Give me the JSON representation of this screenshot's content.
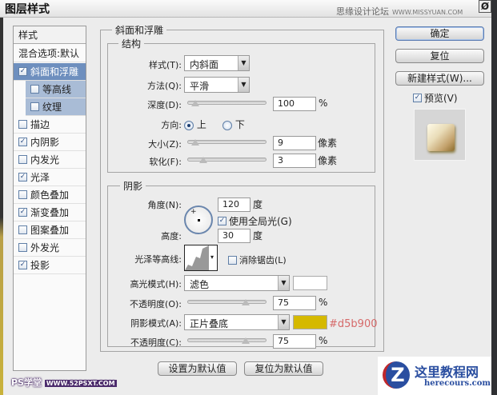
{
  "window": {
    "title": "图层样式",
    "watermark": "思缘设计论坛",
    "watermark_url": "WWW.MISSYUAN.COM",
    "close_icon": "Ø"
  },
  "sidebar": {
    "header": "样式",
    "blend_options": "混合选项:默认",
    "items": [
      {
        "label": "斜面和浮雕",
        "checked": true,
        "selected": true
      },
      {
        "label": "等高线",
        "checked": false,
        "sub": true
      },
      {
        "label": "纹理",
        "checked": false,
        "sub": true
      },
      {
        "label": "描边",
        "checked": false
      },
      {
        "label": "内阴影",
        "checked": true
      },
      {
        "label": "内发光",
        "checked": false
      },
      {
        "label": "光泽",
        "checked": true
      },
      {
        "label": "颜色叠加",
        "checked": false
      },
      {
        "label": "渐变叠加",
        "checked": true
      },
      {
        "label": "图案叠加",
        "checked": false
      },
      {
        "label": "外发光",
        "checked": false
      },
      {
        "label": "投影",
        "checked": true
      }
    ]
  },
  "bevel": {
    "title": "斜面和浮雕",
    "structure": {
      "title": "结构",
      "style_label": "样式(T):",
      "style_value": "内斜面",
      "technique_label": "方法(Q):",
      "technique_value": "平滑",
      "depth_label": "深度(D):",
      "depth_value": "100",
      "depth_unit": "%",
      "depth_slider": 0.05,
      "direction_label": "方向:",
      "direction_up": "上",
      "direction_down": "下",
      "direction_selected": "上",
      "size_label": "大小(Z):",
      "size_value": "9",
      "size_unit": "像素",
      "size_slider": 0.04,
      "soften_label": "软化(F):",
      "soften_value": "3",
      "soften_unit": "像素",
      "soften_slider": 0.16
    },
    "shading": {
      "title": "阴影",
      "angle_label": "角度(N):",
      "angle_value": "120",
      "angle_unit": "度",
      "global_light_label": "使用全局光(G)",
      "global_light_checked": true,
      "altitude_label": "高度:",
      "altitude_value": "30",
      "altitude_unit": "度",
      "gloss_contour_label": "光泽等高线:",
      "antialias_label": "消除锯齿(L)",
      "antialias_checked": false,
      "highlight_mode_label": "高光模式(H):",
      "highlight_mode_value": "滤色",
      "highlight_color": "#ffffff",
      "highlight_opacity_label": "不透明度(O):",
      "highlight_opacity_value": "75",
      "highlight_opacity_unit": "%",
      "highlight_opacity_slider": 0.75,
      "shadow_mode_label": "阴影模式(A):",
      "shadow_mode_value": "正片叠底",
      "shadow_color": "#d5b900",
      "shadow_color_note": "#d5b900",
      "shadow_opacity_label": "不透明度(C):",
      "shadow_opacity_value": "75",
      "shadow_opacity_unit": "%",
      "shadow_opacity_slider": 0.75
    },
    "make_default": "设置为默认值",
    "reset_default": "复位为默认值"
  },
  "buttons": {
    "ok": "确定",
    "reset": "复位",
    "new_style": "新建样式(W)...",
    "preview_label": "预览(V)",
    "preview_checked": true
  },
  "footer": {
    "logo_left": "PS学堂",
    "logo_left_url": "WWW.52PSXT.COM",
    "logo_right": "这里教程网",
    "logo_right_url": "herecours.com"
  }
}
